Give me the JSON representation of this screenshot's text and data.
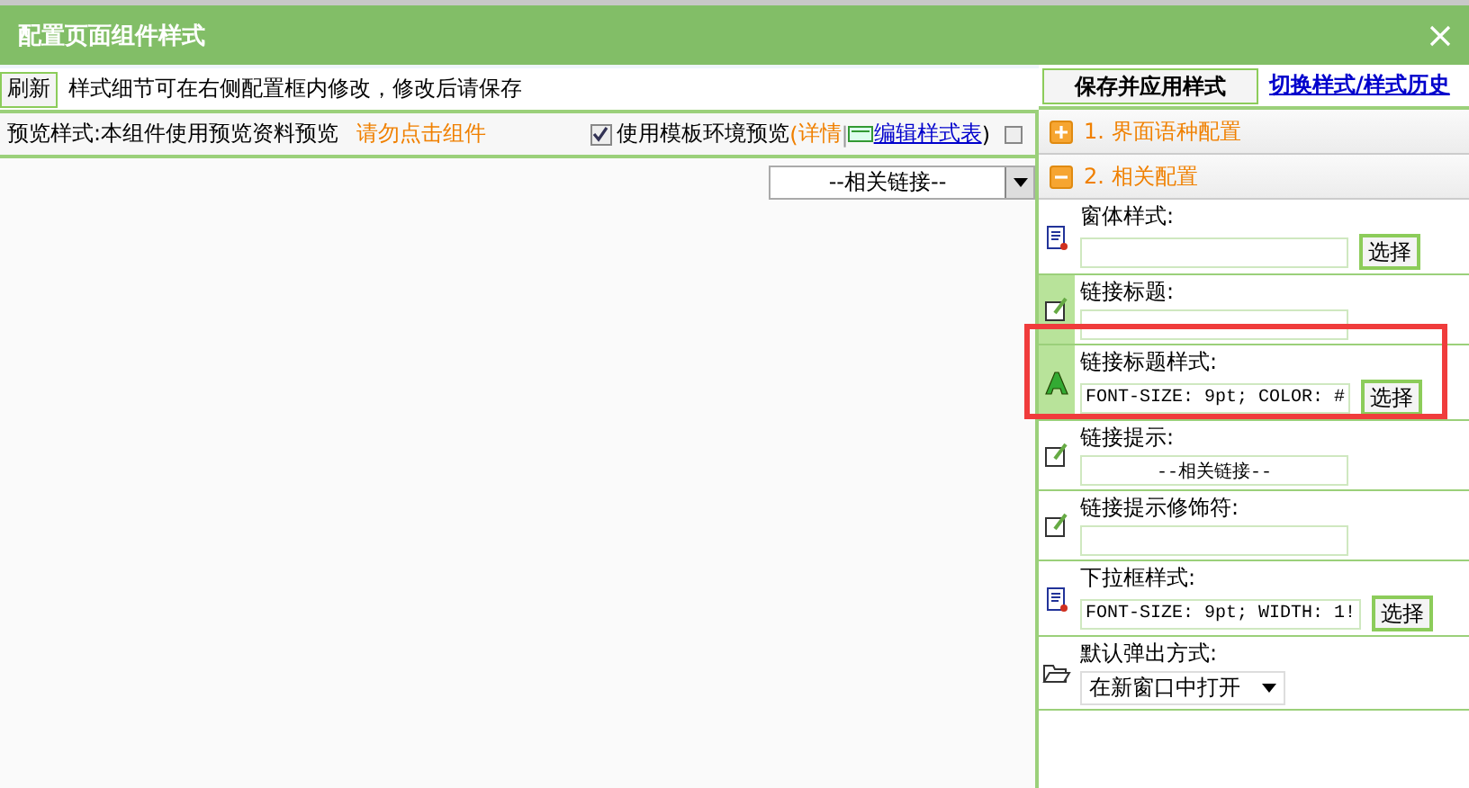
{
  "window": {
    "title": "配置页面组件样式"
  },
  "toolbar": {
    "refresh": "刷新",
    "hint": "样式细节可在右侧配置框内修改，修改后请保存"
  },
  "preview_bar": {
    "label": "预览样式:本组件使用预览资料预览",
    "warning": "请勿点击组件",
    "template_preview": {
      "label": "使用模板环境预览",
      "checked": true
    },
    "open_paren": "(",
    "details_link": "详情",
    "separator": "|",
    "edit_link": "编辑样式表",
    "close_paren": ")",
    "toggle_checked": false
  },
  "preview": {
    "select_value": "--相关链接--"
  },
  "actions": {
    "save": "保存并应用样式",
    "history_link": "切换样式/样式历史"
  },
  "sections": [
    {
      "title": "1. 界面语种配置",
      "expanded": false
    },
    {
      "title": "2. 相关配置",
      "expanded": true
    }
  ],
  "items": [
    {
      "kind": "style",
      "label": "窗体样式:",
      "value": "",
      "button": "选择",
      "highlighted": false
    },
    {
      "kind": "text",
      "label": "链接标题:",
      "value": "",
      "highlighted": true
    },
    {
      "kind": "font",
      "label": "链接标题样式:",
      "value": "FONT-SIZE: 9pt; COLOR: #",
      "button": "选择",
      "highlighted": true,
      "marked": true
    },
    {
      "kind": "text",
      "label": "链接提示:",
      "value": "--相关链接--",
      "centered": true,
      "highlighted": false
    },
    {
      "kind": "text",
      "label": "链接提示修饰符:",
      "value": "",
      "highlighted": false
    },
    {
      "kind": "style",
      "label": "下拉框样式:",
      "value": "FONT-SIZE: 9pt; WIDTH: 1!",
      "button": "选择",
      "highlighted": false
    },
    {
      "kind": "select",
      "label": "默认弹出方式:",
      "value": "在新窗口中打开",
      "highlighted": false
    }
  ]
}
